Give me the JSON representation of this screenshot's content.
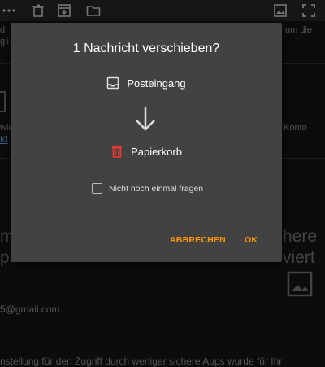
{
  "toolbar": {
    "icons": [
      "more-icon",
      "delete-icon",
      "archive-icon",
      "folder-icon",
      "image-icon",
      "fullscreen-icon"
    ]
  },
  "background": {
    "line_right_top": "um die",
    "line_left_top": "di",
    "line_left_top2": "gli",
    "line_left_mid": "wie",
    "line_left_mid2": "Kl",
    "line_right_mid": "Konto",
    "big_left1": "m",
    "big_left2": "p",
    "big_right1": "here",
    "big_right2": "viert",
    "email": "5@gmail.com",
    "bottom_line": "nstellung für den Zugriff durch weniger sichere Apps wurde für Ihr"
  },
  "dialog": {
    "title": "1 Nachricht verschieben?",
    "source_label": "Posteingang",
    "target_label": "Papierkorb",
    "checkbox_label": "Nicht noch einmal fragen",
    "checkbox_checked": false,
    "cancel_label": "ABBRECHEN",
    "ok_label": "OK",
    "accent_color": "#ff9800",
    "trash_color": "#e53935"
  }
}
